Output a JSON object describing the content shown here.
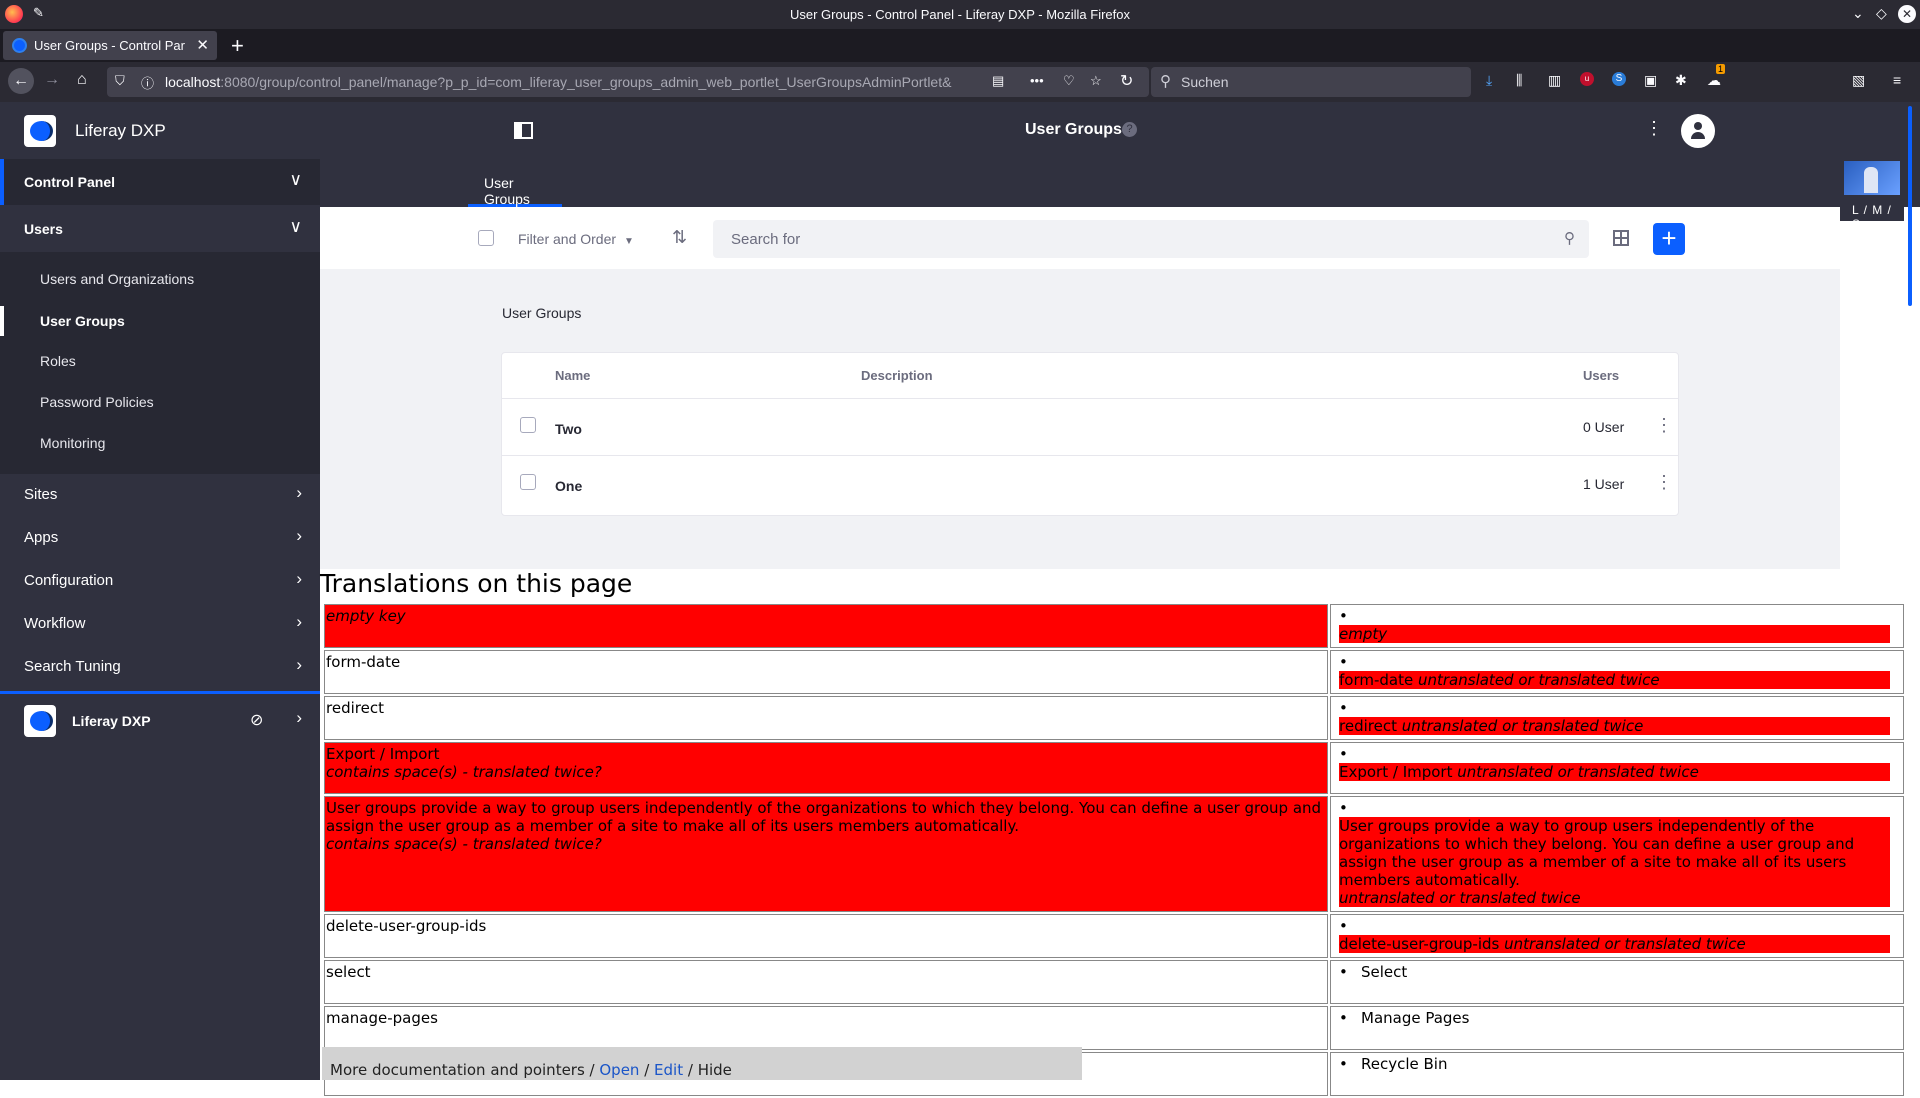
{
  "window": {
    "title": "User Groups - Control Panel - Liferay DXP - Mozilla Firefox"
  },
  "browser": {
    "tab_label": "User Groups - Control Par",
    "url_host": "localhost",
    "url_rest": ":8080/group/control_panel/manage?p_p_id=com_liferay_user_groups_admin_web_portlet_UserGroupsAdminPortlet&",
    "search_placeholder": "Suchen",
    "badge": "1"
  },
  "sidebar": {
    "brand": "Liferay DXP",
    "control_panel": "Control Panel",
    "users_section": "Users",
    "users_items": [
      "Users and Organizations",
      "User Groups",
      "Roles",
      "Password Policies",
      "Monitoring"
    ],
    "sections": [
      "Sites",
      "Apps",
      "Configuration",
      "Workflow",
      "Search Tuning"
    ],
    "site_name": "Liferay DXP"
  },
  "header": {
    "title": "User Groups",
    "help": "?",
    "nav_tab": "User Groups"
  },
  "thumb_label": "L / M / S",
  "toolbar": {
    "filter_label": "Filter and Order",
    "search_placeholder": "Search for"
  },
  "content": {
    "section_title": "User Groups",
    "columns": {
      "name": "Name",
      "description": "Description",
      "users": "Users"
    },
    "rows": [
      {
        "name": "Two",
        "description": "",
        "users": "0 User"
      },
      {
        "name": "One",
        "description": "",
        "users": "1 User"
      }
    ]
  },
  "translations": {
    "heading": "Translations on this page",
    "rows": [
      {
        "key": "empty key",
        "key_italic": true,
        "key_note": "",
        "value": "empty",
        "value_italic": true,
        "value_note": ""
      },
      {
        "key": "form-date",
        "key_note": "",
        "value": "form-date",
        "value_note": "untranslated or translated twice"
      },
      {
        "key": "redirect",
        "key_note": "",
        "value": "redirect",
        "value_note": "untranslated or translated twice"
      },
      {
        "key": "Export / Import",
        "key_note": "contains space(s) - translated twice?",
        "value": "Export / Import",
        "value_note": "untranslated or translated twice"
      },
      {
        "key": "User groups provide a way to group users independently of the organizations to which they belong. You can define a user group and assign the user group as a member of a site to make all of its users members automatically.",
        "key_note": "contains space(s) - translated twice?",
        "value": "User groups provide a way to group users independently of the organizations to which they belong. You can define a user group and assign the user group as a member of a site to make all of its users members automatically.",
        "value_note": "untranslated or translated twice"
      },
      {
        "key": "delete-user-group-ids",
        "key_note": "",
        "value": "delete-user-group-ids",
        "value_note": "untranslated or translated twice"
      },
      {
        "key": "select",
        "key_note": "",
        "value": "Select",
        "value_note": ""
      },
      {
        "key": "manage-pages",
        "key_note": "",
        "value": "Manage Pages",
        "value_note": ""
      },
      {
        "key": "",
        "key_note": "",
        "value": "Recycle Bin",
        "value_note": ""
      }
    ]
  },
  "docbar": {
    "text": "More documentation and pointers / ",
    "open": "Open",
    "sep": " / ",
    "edit": "Edit",
    "hide": " / Hide"
  }
}
